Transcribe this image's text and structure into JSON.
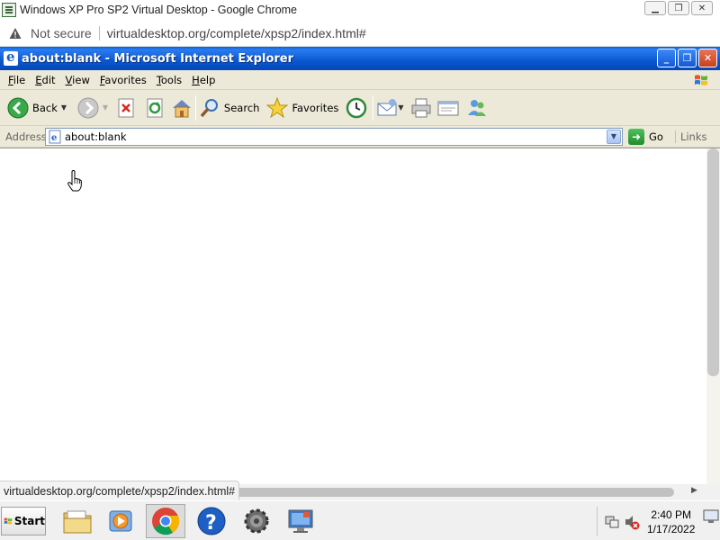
{
  "chrome": {
    "title": "Windows XP Pro SP2 Virtual Desktop - Google Chrome",
    "security_label": "Not secure",
    "url": "virtualdesktop.org/complete/xpsp2/index.html#",
    "status_url": "virtualdesktop.org/complete/xpsp2/index.html#"
  },
  "ie": {
    "title": "about:blank - Microsoft Internet Explorer",
    "menu": [
      "File",
      "Edit",
      "View",
      "Favorites",
      "Tools",
      "Help"
    ],
    "toolbar": {
      "back_label": "Back",
      "search_label": "Search",
      "favorites_label": "Favorites"
    },
    "address": {
      "label": "Address",
      "value": "about:blank",
      "go_label": "Go",
      "links_label": "Links"
    }
  },
  "taskbar": {
    "start_label": "Start",
    "clock_time": "2:40 PM",
    "clock_date": "1/17/2022"
  }
}
